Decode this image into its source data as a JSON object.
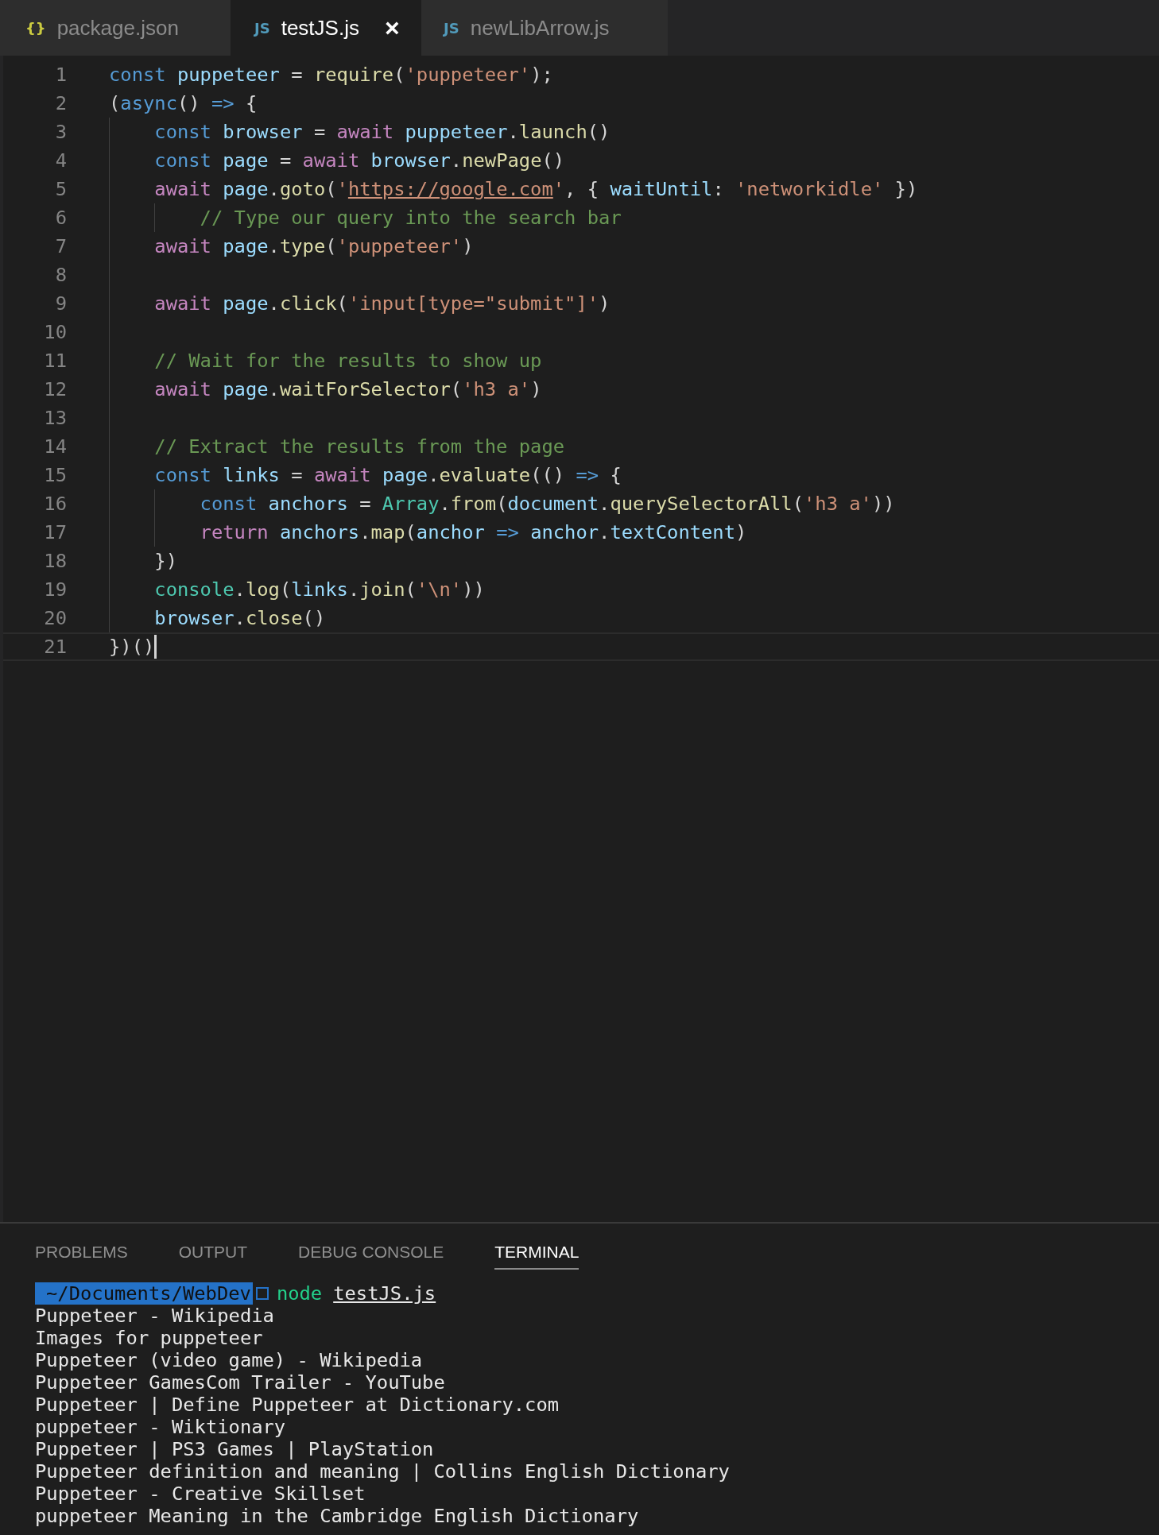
{
  "tabs": [
    {
      "label": "package.json",
      "icon": {
        "text": "{}",
        "color": "#cbcb41"
      },
      "selected": false
    },
    {
      "label": "testJS.js",
      "icon": {
        "text": "JS",
        "color": "#519aba"
      },
      "selected": true,
      "close_glyph": "×"
    },
    {
      "label": "newLibArrow.js",
      "icon": {
        "text": "JS",
        "color": "#519aba"
      },
      "selected": false
    }
  ],
  "editor": {
    "lines": [
      {
        "number": "1",
        "current": false,
        "tokens": [
          {
            "kind": "keyword",
            "text": "const "
          },
          {
            "kind": "variable",
            "text": "puppeteer"
          },
          {
            "kind": "punct",
            "text": " = "
          },
          {
            "kind": "function",
            "text": "require"
          },
          {
            "kind": "punct",
            "text": "("
          },
          {
            "kind": "string",
            "text": "'puppeteer'"
          },
          {
            "kind": "punct",
            "text": ");"
          }
        ]
      },
      {
        "number": "2",
        "current": false,
        "tokens": [
          {
            "kind": "punct",
            "text": "("
          },
          {
            "kind": "keyword",
            "text": "async"
          },
          {
            "kind": "punct",
            "text": "() "
          },
          {
            "kind": "keyword",
            "text": "=>"
          },
          {
            "kind": "punct",
            "text": " {"
          }
        ]
      },
      {
        "number": "3",
        "current": false,
        "tokens": [
          {
            "kind": "keyword",
            "text": "    const "
          },
          {
            "kind": "variable",
            "text": "browser"
          },
          {
            "kind": "punct",
            "text": " = "
          },
          {
            "kind": "control",
            "text": "await "
          },
          {
            "kind": "variable",
            "text": "puppeteer"
          },
          {
            "kind": "punct",
            "text": "."
          },
          {
            "kind": "function",
            "text": "launch"
          },
          {
            "kind": "punct",
            "text": "()"
          }
        ]
      },
      {
        "number": "4",
        "current": false,
        "tokens": [
          {
            "kind": "keyword",
            "text": "    const "
          },
          {
            "kind": "variable",
            "text": "page"
          },
          {
            "kind": "punct",
            "text": " = "
          },
          {
            "kind": "control",
            "text": "await "
          },
          {
            "kind": "variable",
            "text": "browser"
          },
          {
            "kind": "punct",
            "text": "."
          },
          {
            "kind": "function",
            "text": "newPage"
          },
          {
            "kind": "punct",
            "text": "()"
          }
        ]
      },
      {
        "number": "5",
        "current": false,
        "tokens": [
          {
            "kind": "control",
            "text": "    await "
          },
          {
            "kind": "variable",
            "text": "page"
          },
          {
            "kind": "punct",
            "text": "."
          },
          {
            "kind": "function",
            "text": "goto"
          },
          {
            "kind": "punct",
            "text": "("
          },
          {
            "kind": "string",
            "text": "'"
          },
          {
            "kind": "url",
            "text": "https://google.com"
          },
          {
            "kind": "string",
            "text": "'"
          },
          {
            "kind": "punct",
            "text": ", { "
          },
          {
            "kind": "variable",
            "text": "waitUntil"
          },
          {
            "kind": "punct",
            "text": ": "
          },
          {
            "kind": "string",
            "text": "'networkidle'"
          },
          {
            "kind": "punct",
            "text": " })"
          }
        ]
      },
      {
        "number": "6",
        "current": false,
        "tokens": [
          {
            "kind": "comment",
            "text": "        // Type our query into the search bar"
          }
        ]
      },
      {
        "number": "7",
        "current": false,
        "tokens": [
          {
            "kind": "control",
            "text": "    await "
          },
          {
            "kind": "variable",
            "text": "page"
          },
          {
            "kind": "punct",
            "text": "."
          },
          {
            "kind": "function",
            "text": "type"
          },
          {
            "kind": "punct",
            "text": "("
          },
          {
            "kind": "string",
            "text": "'puppeteer'"
          },
          {
            "kind": "punct",
            "text": ")"
          }
        ]
      },
      {
        "number": "8",
        "current": false
      },
      {
        "number": "9",
        "current": false,
        "tokens": [
          {
            "kind": "control",
            "text": "    await "
          },
          {
            "kind": "variable",
            "text": "page"
          },
          {
            "kind": "punct",
            "text": "."
          },
          {
            "kind": "function",
            "text": "click"
          },
          {
            "kind": "punct",
            "text": "("
          },
          {
            "kind": "string",
            "text": "'input[type=\"submit\"]'"
          },
          {
            "kind": "punct",
            "text": ")"
          }
        ]
      },
      {
        "number": "10",
        "current": false
      },
      {
        "number": "11",
        "current": false,
        "tokens": [
          {
            "kind": "comment",
            "text": "    // Wait for the results to show up"
          }
        ]
      },
      {
        "number": "12",
        "current": false,
        "tokens": [
          {
            "kind": "control",
            "text": "    await "
          },
          {
            "kind": "variable",
            "text": "page"
          },
          {
            "kind": "punct",
            "text": "."
          },
          {
            "kind": "function",
            "text": "waitForSelector"
          },
          {
            "kind": "punct",
            "text": "("
          },
          {
            "kind": "string",
            "text": "'h3 a'"
          },
          {
            "kind": "punct",
            "text": ")"
          }
        ]
      },
      {
        "number": "13",
        "current": false
      },
      {
        "number": "14",
        "current": false,
        "tokens": [
          {
            "kind": "comment",
            "text": "    // Extract the results from the page"
          }
        ]
      },
      {
        "number": "15",
        "current": false,
        "tokens": [
          {
            "kind": "keyword",
            "text": "    const "
          },
          {
            "kind": "variable",
            "text": "links"
          },
          {
            "kind": "punct",
            "text": " = "
          },
          {
            "kind": "control",
            "text": "await "
          },
          {
            "kind": "variable",
            "text": "page"
          },
          {
            "kind": "punct",
            "text": "."
          },
          {
            "kind": "function",
            "text": "evaluate"
          },
          {
            "kind": "punct",
            "text": "(() "
          },
          {
            "kind": "keyword",
            "text": "=>"
          },
          {
            "kind": "punct",
            "text": " {"
          }
        ]
      },
      {
        "number": "16",
        "current": false,
        "tokens": [
          {
            "kind": "keyword",
            "text": "        const "
          },
          {
            "kind": "variable",
            "text": "anchors"
          },
          {
            "kind": "punct",
            "text": " = "
          },
          {
            "kind": "class",
            "text": "Array"
          },
          {
            "kind": "punct",
            "text": "."
          },
          {
            "kind": "function",
            "text": "from"
          },
          {
            "kind": "punct",
            "text": "("
          },
          {
            "kind": "variable",
            "text": "document"
          },
          {
            "kind": "punct",
            "text": "."
          },
          {
            "kind": "function",
            "text": "querySelectorAll"
          },
          {
            "kind": "punct",
            "text": "("
          },
          {
            "kind": "string",
            "text": "'h3 a'"
          },
          {
            "kind": "punct",
            "text": "))"
          }
        ]
      },
      {
        "number": "17",
        "current": false,
        "tokens": [
          {
            "kind": "control",
            "text": "        return "
          },
          {
            "kind": "variable",
            "text": "anchors"
          },
          {
            "kind": "punct",
            "text": "."
          },
          {
            "kind": "function",
            "text": "map"
          },
          {
            "kind": "punct",
            "text": "("
          },
          {
            "kind": "variable",
            "text": "anchor "
          },
          {
            "kind": "keyword",
            "text": "=> "
          },
          {
            "kind": "variable",
            "text": "anchor"
          },
          {
            "kind": "punct",
            "text": "."
          },
          {
            "kind": "variable",
            "text": "textContent"
          },
          {
            "kind": "punct",
            "text": ")"
          }
        ]
      },
      {
        "number": "18",
        "current": false,
        "tokens": [
          {
            "kind": "punct",
            "text": "    })"
          }
        ]
      },
      {
        "number": "19",
        "current": false,
        "tokens": [
          {
            "kind": "class",
            "text": "    console"
          },
          {
            "kind": "punct",
            "text": "."
          },
          {
            "kind": "function",
            "text": "log"
          },
          {
            "kind": "punct",
            "text": "("
          },
          {
            "kind": "variable",
            "text": "links"
          },
          {
            "kind": "punct",
            "text": "."
          },
          {
            "kind": "function",
            "text": "join"
          },
          {
            "kind": "punct",
            "text": "("
          },
          {
            "kind": "string",
            "text": "'\\n'"
          },
          {
            "kind": "punct",
            "text": "))"
          }
        ]
      },
      {
        "number": "20",
        "current": false,
        "tokens": [
          {
            "kind": "variable",
            "text": "    browser"
          },
          {
            "kind": "punct",
            "text": "."
          },
          {
            "kind": "function",
            "text": "close"
          },
          {
            "kind": "punct",
            "text": "()"
          }
        ]
      },
      {
        "number": "21",
        "current": true,
        "tokens": [
          {
            "kind": "punct",
            "text": "})()"
          }
        ]
      }
    ]
  },
  "panel": {
    "tabs": [
      {
        "label": "PROBLEMS",
        "selected": false
      },
      {
        "label": "OUTPUT",
        "selected": false
      },
      {
        "label": "DEBUG CONSOLE",
        "selected": false
      },
      {
        "label": "TERMINAL",
        "selected": true
      }
    ],
    "terminal": {
      "prompt_path": "~/Documents/WebDev",
      "command": "node",
      "argument": "testJS.js",
      "output": [
        "Puppeteer - Wikipedia",
        "Images for puppeteer",
        "Puppeteer (video game) - Wikipedia",
        "Puppeteer GamesCom Trailer - YouTube",
        "Puppeteer | Define Puppeteer at Dictionary.com",
        "puppeteer - Wiktionary",
        "Puppeteer | PS3 Games | PlayStation",
        "Puppeteer definition and meaning | Collins English Dictionary",
        "Puppeteer - Creative Skillset",
        "puppeteer Meaning in the Cambridge English Dictionary"
      ]
    }
  }
}
